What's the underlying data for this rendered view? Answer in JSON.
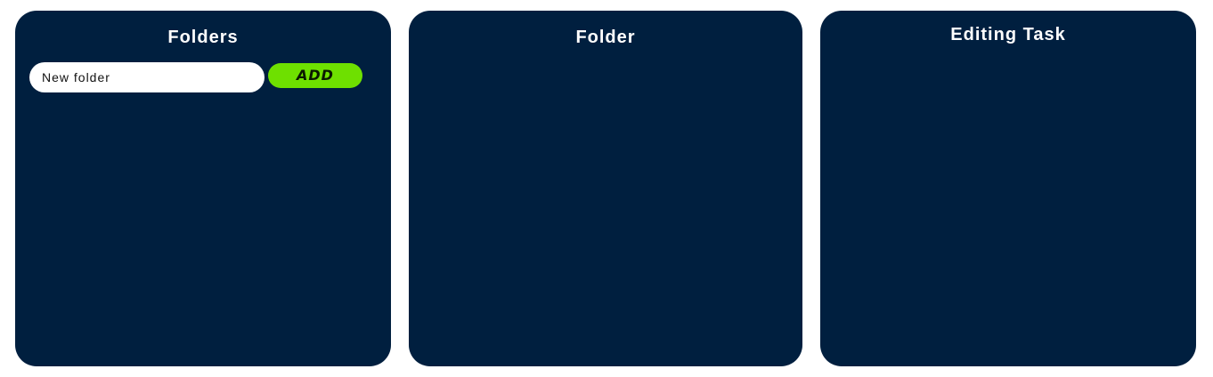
{
  "colors": {
    "panel_background": "#001f3f",
    "page_background": "#ffffff",
    "accent_button": "#6ee000",
    "title_text": "#ffffff"
  },
  "folders_panel": {
    "title": "Folders",
    "new_folder_input": {
      "value": "",
      "placeholder": "New folder"
    },
    "add_button_label": "ADD"
  },
  "folder_panel": {
    "title": "Folder"
  },
  "editing_panel": {
    "title": "Editing Task"
  }
}
